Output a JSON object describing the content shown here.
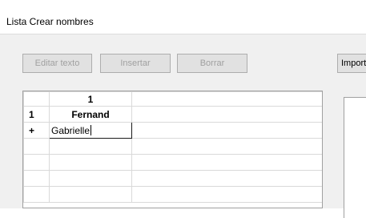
{
  "window": {
    "title": "Lista Crear nombres"
  },
  "toolbar": {
    "edit_label": "Editar texto",
    "insert_label": "Insertar",
    "delete_label": "Borrar",
    "import_label": "Import"
  },
  "grid": {
    "column_header": "1",
    "rows": [
      {
        "header": "1",
        "value": "Fernand"
      },
      {
        "header": "+",
        "value": "Gabrielle"
      }
    ]
  }
}
